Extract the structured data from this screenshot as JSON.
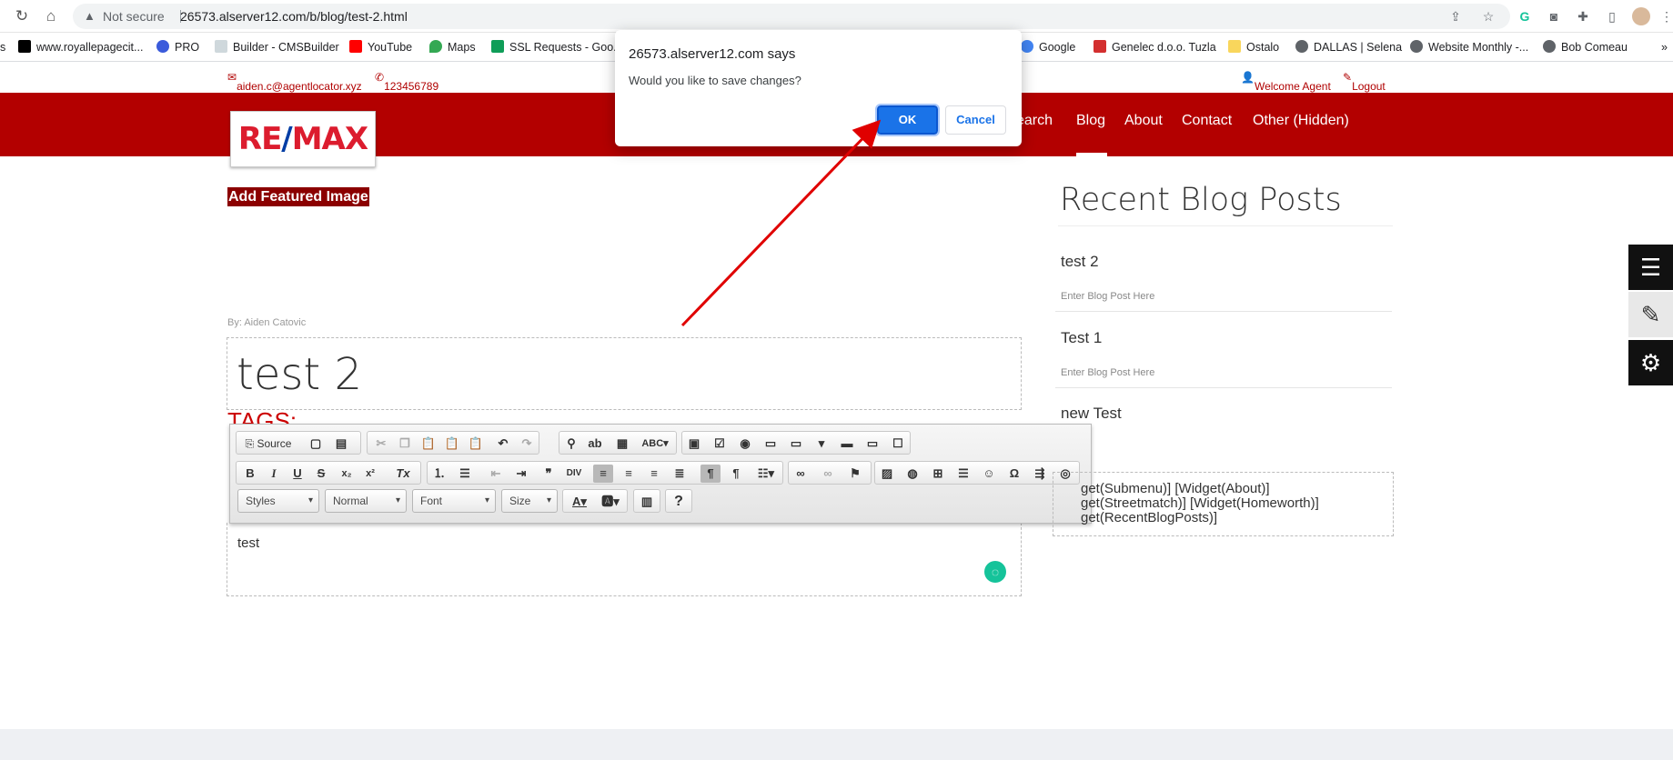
{
  "browser": {
    "not_secure": "Not secure",
    "url": "26573.alserver12.com/b/blog/test-2.html",
    "bookmarks": [
      {
        "label": "www.royallepagecit...",
        "color": "#000000"
      },
      {
        "label": "PRO",
        "color": "#3b5bdb"
      },
      {
        "label": "Builder - CMSBuilder",
        "color": "#90a4ae"
      },
      {
        "label": "YouTube",
        "color": "#ff0000"
      },
      {
        "label": "Maps",
        "color": "#34a853"
      },
      {
        "label": "SSL Requests - Goo...",
        "color": "#0f9d58"
      },
      {
        "label": "Google",
        "color": "#4285f4"
      },
      {
        "label": "Genelec d.o.o. Tuzla",
        "color": "#d32f2f"
      },
      {
        "label": "Ostalo",
        "color": "#f9d65c"
      },
      {
        "label": "DALLAS | Selena",
        "color": "#5f6368"
      },
      {
        "label": "Website Monthly -...",
        "color": "#5f6368"
      },
      {
        "label": "Bob Comeau",
        "color": "#5f6368"
      }
    ]
  },
  "site": {
    "email": "aiden.c@agentlocator.xyz",
    "phone": "123456789",
    "welcome": "Welcome Agent",
    "logout": "Logout",
    "logo_re": "RE",
    "logo_slash": "/",
    "logo_max": "MAX",
    "nav": [
      "Search",
      "Blog",
      "About",
      "Contact",
      "Other (Hidden)"
    ],
    "nav_visible": [
      "earch",
      "Blog",
      "About",
      "Contact",
      "Other (Hidden)"
    ]
  },
  "post": {
    "featured_button": "Add Featured Image",
    "byline": "By: Aiden Catovic",
    "title": "test 2",
    "tags_label": "TAGS:",
    "body": "test"
  },
  "editor": {
    "source_label": "Source",
    "combos": [
      "Styles",
      "Normal",
      "Font",
      "Size"
    ]
  },
  "sidebar": {
    "heading": "Recent Blog Posts",
    "posts": [
      {
        "title": "test 2",
        "sub": "Enter Blog Post Here"
      },
      {
        "title": "Test 1",
        "sub": "Enter Blog Post Here"
      },
      {
        "title": "new Test",
        "sub": ""
      }
    ],
    "widgets_line1": "[Widget(Submenu)] [Widget(About)]",
    "widgets_line2": "[Widget(Streetmatch)] [Widget(Homeworth)]",
    "widgets_line3": "[Widget(RecentBlogPosts)]",
    "widgets_visible": [
      "get(Submenu)] [Widget(About)]",
      "get(Streetmatch)] [Widget(Homeworth)]",
      "get(RecentBlogPosts)]"
    ]
  },
  "dialog": {
    "host": "26573.alserver12.com says",
    "message": "Would you like to save changes?",
    "ok": "OK",
    "cancel": "Cancel"
  },
  "colors": {
    "brand_red": "#b30000",
    "ok_blue": "#1a73e8",
    "arrow_red": "#e00000"
  }
}
